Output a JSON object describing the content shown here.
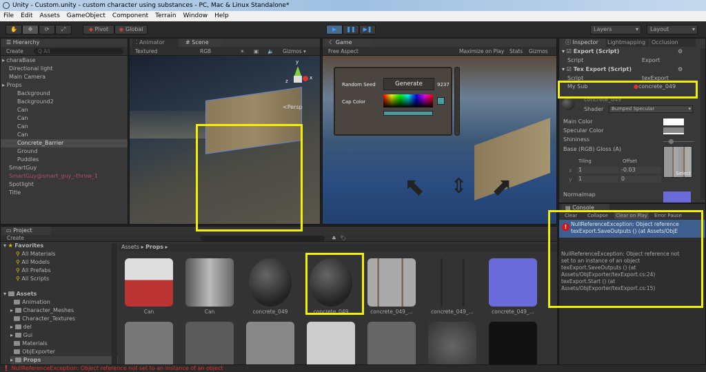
{
  "window": {
    "title": "Unity - Custom.unity - custom character using substances - PC, Mac & Linux Standalone*"
  },
  "menu": [
    "File",
    "Edit",
    "Assets",
    "GameObject",
    "Component",
    "Terrain",
    "Window",
    "Help"
  ],
  "toolbar": {
    "pivot": "Pivot",
    "global": "Global",
    "layers": "Layers",
    "layout": "Layout"
  },
  "hierarchy": {
    "tab": "Hierarchy",
    "create": "Create",
    "search_placeholder": "All",
    "items": [
      {
        "label": "charaBase"
      },
      {
        "label": "Directional light"
      },
      {
        "label": "Main Camera"
      },
      {
        "label": "Props"
      },
      {
        "label": "Background"
      },
      {
        "label": "Background2"
      },
      {
        "label": "Can"
      },
      {
        "label": "Can"
      },
      {
        "label": "Can"
      },
      {
        "label": "Can"
      },
      {
        "label": "Concrete_Barrier"
      },
      {
        "label": "Ground"
      },
      {
        "label": "Puddles"
      },
      {
        "label": "SmartGuy"
      },
      {
        "label": "SmartGuy@smart_guy_-throw_1"
      },
      {
        "label": "Spotlight"
      },
      {
        "label": "Title"
      }
    ]
  },
  "scene": {
    "tab_animator": "Animator",
    "tab_scene": "Scene",
    "render_mode": "Textured",
    "channel": "RGB",
    "gizmos": "Gizmos",
    "persp": "Persp",
    "axis_y": "y",
    "axis_x": "x",
    "axis_z": "z"
  },
  "game": {
    "tab": "Game",
    "aspect": "Free Aspect",
    "maximize": "Maximize on Play",
    "stats": "Stats",
    "gizmos": "Gizmos",
    "random_seed": "Random Seed",
    "generate": "Generate",
    "seed_value": "9237",
    "cap_color": "Cap Color",
    "cap_color_hex": "#4a9aa0"
  },
  "inspector": {
    "tabs": [
      "Inspector",
      "Lightmapping",
      "Occlusion"
    ],
    "export_script": "Export (Script)",
    "script_label": "Script",
    "export_value": "Export",
    "tex_export_script": "Tex Export (Script)",
    "tex_export_value": "texExport",
    "my_sub_label": "My Sub",
    "my_sub_value": "concrete_049",
    "material_name": "concrete_049",
    "shader_label": "Shader",
    "shader_value": "Bumped Specular",
    "main_color": "Main Color",
    "specular_color": "Specular Color",
    "shininess": "Shininess",
    "base_map": "Base (RGB) Gloss (A)",
    "tiling": "Tiling",
    "offset": "Offset",
    "x": "x",
    "y": "y",
    "tiling_x": "1",
    "tiling_y": "1",
    "offset_x": "-0.03",
    "offset_y": "0",
    "select": "Select",
    "normalmap": "Normalmap"
  },
  "console": {
    "tab": "Console",
    "buttons": [
      "Clear",
      "Collapse",
      "Clear on Play",
      "Error Pause"
    ],
    "entry_line1": "NullReferenceException: Object reference",
    "entry_line2": "texExport.SaveOutputs () (at Assets/ObjE",
    "detail": [
      "NullReferenceException: Object reference not",
      "set to an instance of an object",
      "texExport.SaveOutputs () (at",
      "Assets/ObjExporter/texExport.cs:24)",
      "texExport.Start () (at",
      "Assets/ObjExporter/texExport.cs:15)"
    ]
  },
  "project": {
    "tab": "Project",
    "create": "Create",
    "favorites": "Favorites",
    "favorite_items": [
      "All Materials",
      "All Models",
      "All Prefabs",
      "All Scripts"
    ],
    "assets": "Assets",
    "folders": [
      "Animation",
      "Character_Meshes",
      "Character_Textures",
      "del",
      "Gui",
      "Materials",
      "ObjExporter",
      "Props"
    ],
    "breadcrumb": [
      "Assets",
      "Props"
    ],
    "grid": [
      "Can",
      "Can",
      "concrete_049",
      "concrete_049",
      "concrete_049_...",
      "concrete_049_...",
      "concrete_049_..."
    ]
  },
  "status": {
    "message": "NullReferenceException: Object reference not set to an instance of an object"
  }
}
